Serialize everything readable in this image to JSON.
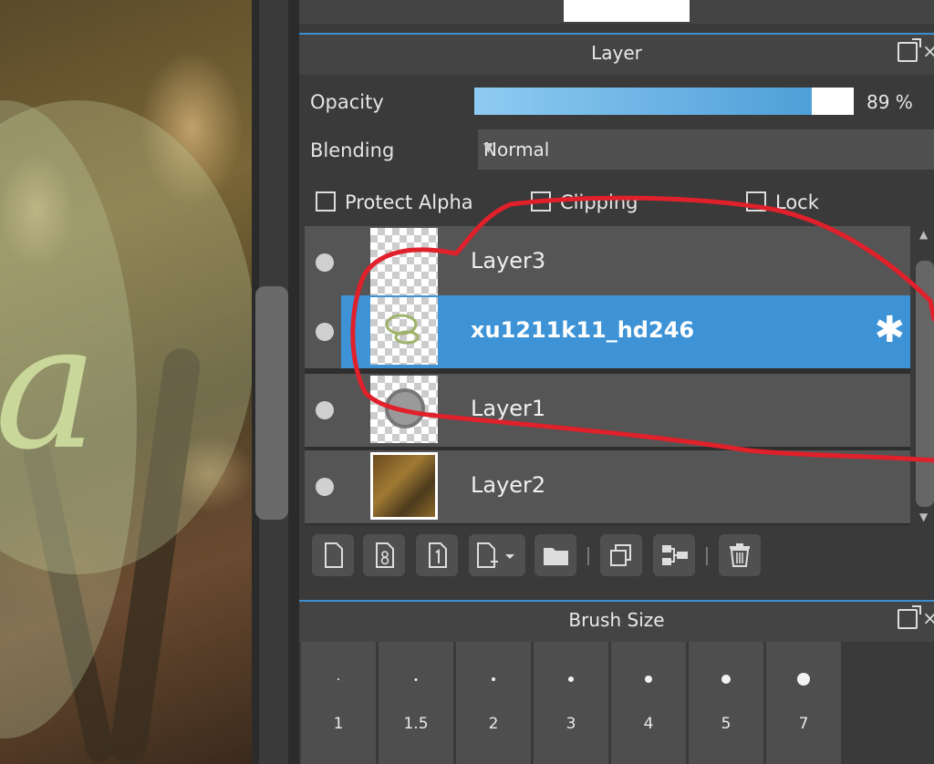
{
  "layer_panel": {
    "title": "Layer",
    "opacity_label": "Opacity",
    "opacity_value": "89 %",
    "opacity_fraction": 0.89,
    "blending_label": "Blending",
    "blending_value": "Normal",
    "checkboxes": {
      "protect_alpha": "Protect Alpha",
      "clipping": "Clipping",
      "lock": "Lock"
    },
    "layers": [
      {
        "name": "Layer3",
        "selected": false
      },
      {
        "name": "xu1211k11_hd246",
        "selected": true
      },
      {
        "name": "Layer1",
        "selected": false
      },
      {
        "name": "Layer2",
        "selected": false
      }
    ]
  },
  "brush_panel": {
    "title": "Brush Size",
    "sizes": [
      "1",
      "1.5",
      "2",
      "3",
      "4",
      "5",
      "7"
    ]
  },
  "colors": {
    "accent": "#3d93d6",
    "annotation": "#e0202a"
  }
}
